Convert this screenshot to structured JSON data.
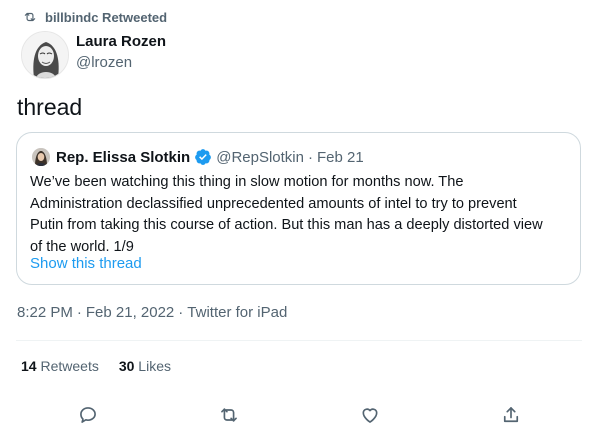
{
  "retweet": {
    "label": "billbindc Retweeted",
    "icon": "retweet-icon"
  },
  "author": {
    "name": "Laura Rozen",
    "handle": "@lrozen",
    "avatar_icon": "avatar-icon"
  },
  "tweet": {
    "text": "thread"
  },
  "quoted_tweet": {
    "name": "Rep. Elissa Slotkin",
    "verified_icon": "verified-badge-icon",
    "handle": "@RepSlotkin",
    "separator": "·",
    "date": "Feb 21",
    "text_lines": [
      "We’ve been watching this thing in slow motion for months now. The",
      "Administration declassified unprecedented amounts of intel to try to prevent",
      "Putin from taking this course of action. But this man has a deeply distorted view",
      "of the world. 1/9"
    ],
    "show_thread": "Show this thread"
  },
  "meta": {
    "time": "8:22 PM",
    "date": "Feb 21, 2022",
    "source": "Twitter for iPad",
    "separator": "·"
  },
  "stats": {
    "retweets_count": "14",
    "retweets_label": "Retweets",
    "likes_count": "30",
    "likes_label": "Likes"
  },
  "actions": {
    "icons": [
      "reply-icon",
      "retweet-icon",
      "like-icon",
      "share-icon"
    ]
  },
  "colors": {
    "link": "#1d9bf0",
    "muted": "#536471",
    "text": "#0f1419",
    "border": "#cfd9de"
  }
}
